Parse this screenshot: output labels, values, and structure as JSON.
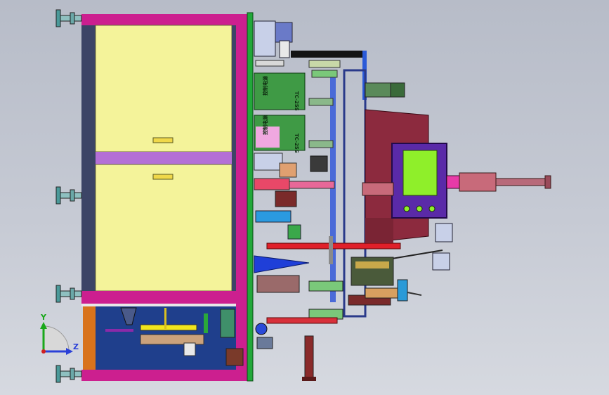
{
  "viewport": {
    "background_top": "#b7bcc8",
    "background_bottom": "#d6d9e0"
  },
  "model": {
    "controller_labels": [
      {
        "model": "TC-25S",
        "name": "控制电源"
      },
      {
        "model": "TC-25S",
        "name": "控制电源"
      }
    ]
  },
  "axis_triad": {
    "y_label": "Y",
    "z_label": "Z",
    "y_color": "#1aa81a",
    "z_color": "#2a40d8",
    "x_color": "#d02020"
  },
  "palette": {
    "cabinet_frame": "#cc1f8f",
    "panel_yellow": "#f4f39a",
    "panel_divider": "#b46fd6",
    "base_blue": "#1f3f8c",
    "green_rail": "#22a83a",
    "controller_green": "#3f9a45",
    "maroon_plate": "#8c2a3e",
    "hmi_frame": "#5a2aa8",
    "hmi_screen": "#8fef2a",
    "orange_panel": "#d8731c"
  }
}
